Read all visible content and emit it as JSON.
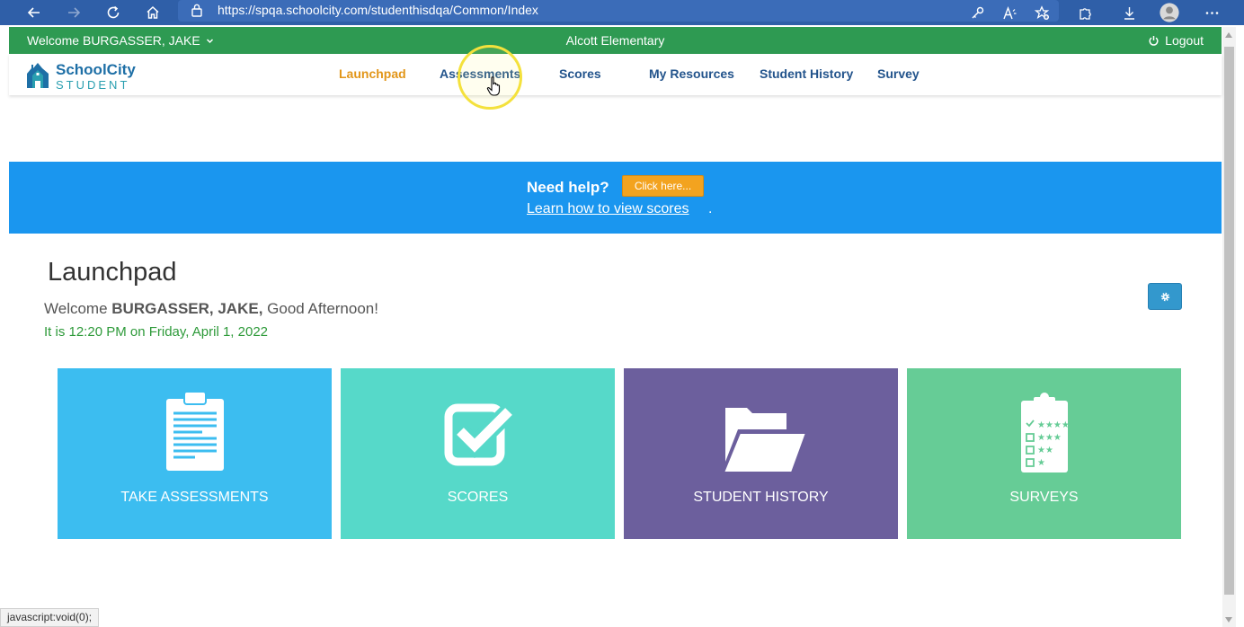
{
  "browser": {
    "url": "https://spqa.schoolcity.com/studenthisdqa/Common/Index",
    "status_text": "javascript:void(0);"
  },
  "topbar": {
    "welcome": "Welcome BURGASSER, JAKE",
    "school": "Alcott Elementary",
    "logout": "Logout"
  },
  "logo": {
    "line1": "SchoolCity",
    "line2": "STUDENT"
  },
  "nav": {
    "items": [
      {
        "label": "Launchpad",
        "active": true
      },
      {
        "label": "Assessments"
      },
      {
        "label": "Scores"
      },
      {
        "label": "My Resources"
      },
      {
        "label": "Student History"
      },
      {
        "label": "Survey"
      }
    ]
  },
  "help": {
    "question": "Need help?",
    "button": "Click here...",
    "link": "Learn how to view scores",
    "link_suffix": "."
  },
  "launchpad": {
    "title": "Launchpad",
    "greeting_prefix": "Welcome",
    "user": "BURGASSER, JAKE,",
    "greeting_suffix": "Good Afternoon!",
    "time": "It is 12:20 PM on Friday, April 1, 2022"
  },
  "tiles": [
    {
      "label": "TAKE ASSESSMENTS",
      "color": "#3cbdf0",
      "icon": "clipboard-icon"
    },
    {
      "label": "SCORES",
      "color": "#56d9c9",
      "icon": "checkbox-icon"
    },
    {
      "label": "STUDENT HISTORY",
      "color": "#6c5f9d",
      "icon": "folder-icon"
    },
    {
      "label": "SURVEYS",
      "color": "#66cc96",
      "icon": "survey-clipboard-icon"
    }
  ],
  "colors": {
    "topbar": "#2e9a52",
    "banner": "#1a96ef",
    "active_nav": "#e29619",
    "nav": "#23548c"
  }
}
